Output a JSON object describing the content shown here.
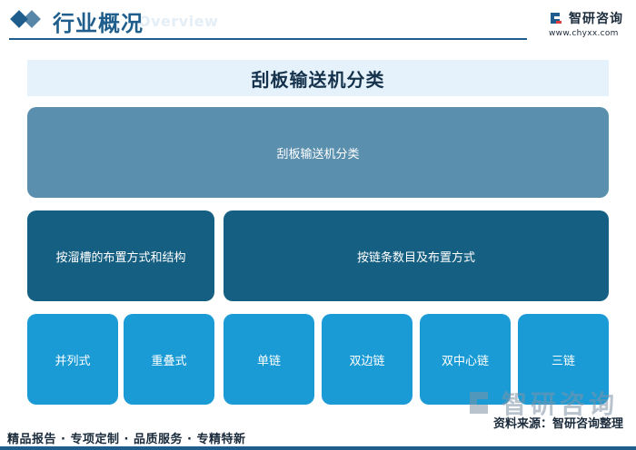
{
  "header": {
    "section_title": "行业概况",
    "section_subtitle": "Overview",
    "brand_name": "智研咨询",
    "brand_url": "www.chyxx.com"
  },
  "diagram": {
    "title": "刮板输送机分类",
    "root": "刮板输送机分类",
    "groups": [
      {
        "label": "按溜槽的布置方式和结构",
        "children": [
          "并列式",
          "重叠式"
        ]
      },
      {
        "label": "按链条数目及布置方式",
        "children": [
          "单链",
          "双边链",
          "双中心链",
          "三链"
        ]
      }
    ]
  },
  "watermark": "智研咨询",
  "source": "资料来源：智研咨询整理",
  "footer": "精品报告 · 专项定制 · 品质服务 · 专精特新",
  "colors": {
    "accent": "#1f5e8c",
    "root_box": "#5b8fae",
    "level2_box": "#155f82",
    "level3_box": "#1a9bd6",
    "title_band": "#e6f2fb"
  }
}
